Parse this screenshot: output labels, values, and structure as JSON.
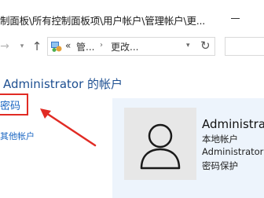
{
  "window": {
    "title": "制面板\\所有控制面板项\\用户帐户\\管理帐户\\更..."
  },
  "navbar": {
    "forward_icon": "arrow-right-icon",
    "dropdown_icon": "chevron-down-icon",
    "up_icon": "arrow-up-icon",
    "address": {
      "icon": "control-panel-icon",
      "overflow": "«",
      "crumbs": [
        "管...",
        "更改..."
      ],
      "separator": "›",
      "dropdown_icon": "chevron-down-icon",
      "refresh_icon": "refresh-icon"
    }
  },
  "main": {
    "title": "Administrator 的帐户",
    "change_password_link": "密码",
    "manage_other_link": "其他帐户"
  },
  "account": {
    "avatar_icon": "user-silhouette-icon",
    "name": "Administrator",
    "type": "本地帐户",
    "group": "Administrator",
    "password_status": "密码保护"
  },
  "colors": {
    "title": "#1d4f91",
    "link": "#1a66c2",
    "highlight": "#e12b24",
    "panel": "#edf4fc"
  }
}
